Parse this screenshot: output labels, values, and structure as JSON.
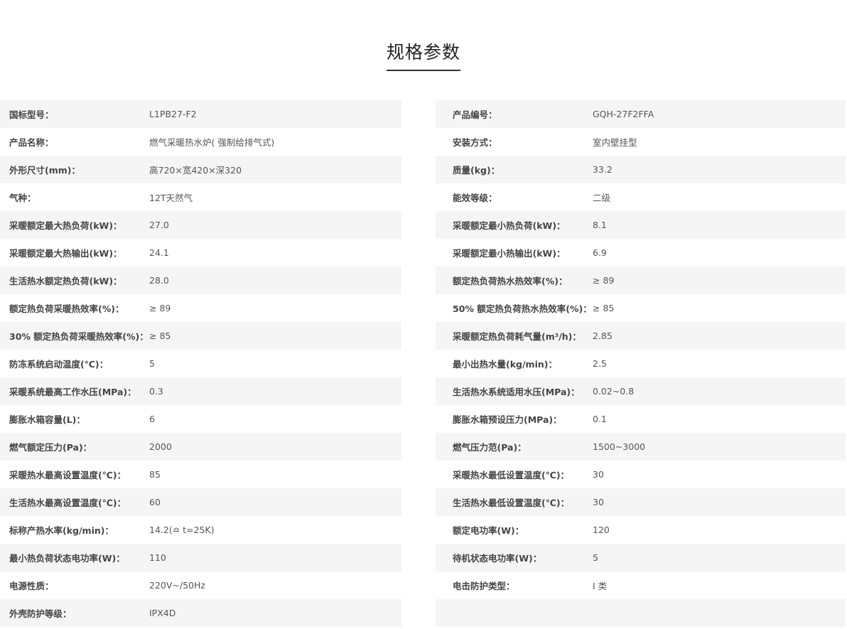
{
  "page_title": "规格参数",
  "left": [
    {
      "label": "国标型号：",
      "value": "L1PB27-F2"
    },
    {
      "label": "产品名称：",
      "value": "燃气采暖热水炉( 强制给排气式)"
    },
    {
      "label": "外形尺寸(mm)：",
      "value": "高720×宽420×深320"
    },
    {
      "label": "气种：",
      "value": "12T天然气"
    },
    {
      "label": "采暖额定最大热负荷(kW)：",
      "value": "27.0"
    },
    {
      "label": "采暖额定最大热输出(kW)：",
      "value": "24.1"
    },
    {
      "label": "生活热水额定热负荷(kW)：",
      "value": "28.0"
    },
    {
      "label": "额定热负荷采暖热效率(%)：",
      "value": "≥ 89"
    },
    {
      "label": "30% 额定热负荷采暖热效率(%)：",
      "value": "≥ 85"
    },
    {
      "label": "防冻系统启动温度(℃)：",
      "value": "5"
    },
    {
      "label": "采暖系统最高工作水压(MPa)：",
      "value": "0.3"
    },
    {
      "label": "膨胀水箱容量(L)：",
      "value": "6"
    },
    {
      "label": "燃气额定压力(Pa)：",
      "value": "2000"
    },
    {
      "label": "采暖热水最高设置温度(℃)：",
      "value": "85"
    },
    {
      "label": "生活热水最高设置温度(℃)：",
      "value": "60"
    },
    {
      "label": "标称产热水率(kg/min)：",
      "value": "14.2(≏ t=25K)"
    },
    {
      "label": "最小热负荷状态电功率(W)：",
      "value": "110"
    },
    {
      "label": "电源性质：",
      "value": "220V~/50Hz"
    },
    {
      "label": "外壳防护等级：",
      "value": "IPX4D"
    }
  ],
  "right": [
    {
      "label": "产品编号：",
      "value": "GQH-27F2FFA"
    },
    {
      "label": "安装方式：",
      "value": "室内壁挂型"
    },
    {
      "label": "质量(kg)：",
      "value": "33.2"
    },
    {
      "label": "能效等级：",
      "value": "二级"
    },
    {
      "label": "采暖额定最小热负荷(kW)：",
      "value": "8.1"
    },
    {
      "label": "采暖额定最小热输出(kW)：",
      "value": "6.9"
    },
    {
      "label": "额定热负荷热水热效率(%)：",
      "value": "≥ 89"
    },
    {
      "label": "50% 额定热负荷热水热效率(%)：",
      "value": "≥ 85"
    },
    {
      "label": "采暖额定热负荷耗气量(m³/h)：",
      "value": "2.85"
    },
    {
      "label": "最小出热水量(kg/min)：",
      "value": "2.5"
    },
    {
      "label": "生活热水系统适用水压(MPa)：",
      "value": "0.02~0.8"
    },
    {
      "label": "膨胀水箱预设压力(MPa)：",
      "value": "0.1"
    },
    {
      "label": "燃气压力范(Pa)：",
      "value": "1500~3000"
    },
    {
      "label": "采暖热水最低设置温度(℃)：",
      "value": "30"
    },
    {
      "label": "生活热水最低设置温度(℃)：",
      "value": "30"
    },
    {
      "label": "额定电功率(W)：",
      "value": "120"
    },
    {
      "label": "待机状态电功率(W)：",
      "value": "5"
    },
    {
      "label": "电击防护类型：",
      "value": "I 类"
    },
    {
      "label": "",
      "value": ""
    }
  ]
}
